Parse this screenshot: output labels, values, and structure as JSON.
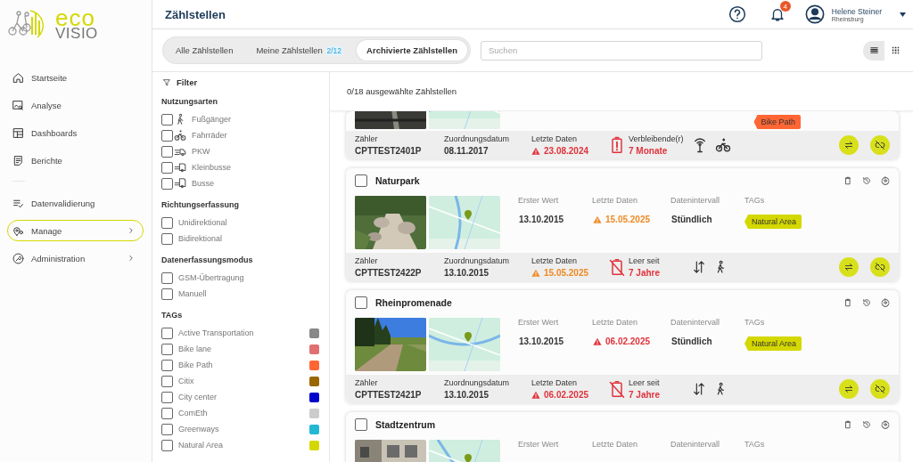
{
  "sidebar": {
    "logo": {
      "line1": "eco",
      "line2": "VISIO"
    },
    "groups": [
      [
        {
          "label": "Startseite",
          "selected": false,
          "expandable": false
        },
        {
          "label": "Analyse",
          "selected": false,
          "expandable": false
        },
        {
          "label": "Dashboards",
          "selected": false,
          "expandable": false
        },
        {
          "label": "Berichte",
          "selected": false,
          "expandable": false
        }
      ],
      [
        {
          "label": "Datenvalidierung",
          "selected": false,
          "expandable": false
        },
        {
          "label": "Manage",
          "selected": true,
          "expandable": true
        },
        {
          "label": "Administration",
          "selected": false,
          "expandable": true
        }
      ]
    ]
  },
  "header": {
    "title": "Zählstellen",
    "notifications": "4",
    "user": {
      "name": "Helene Steiner",
      "location": "Rheinsburg"
    }
  },
  "tabs": [
    {
      "label": "Alle Zählstellen",
      "selected": false
    },
    {
      "label": "Meine Zählstellen",
      "badge": "2/12",
      "selected": false
    },
    {
      "label": "Archivierte Zählstellen",
      "selected": true
    }
  ],
  "search": {
    "placeholder": "Suchen"
  },
  "view_toggle": [
    {
      "kind": "list",
      "selected": true
    },
    {
      "kind": "grid",
      "selected": false
    }
  ],
  "filter": {
    "title": "Filter",
    "sections": [
      {
        "title": "Nutzungsarten",
        "kind": "usage",
        "items": [
          {
            "label": "Fußgänger",
            "checked": false
          },
          {
            "label": "Fahrräder",
            "checked": false
          },
          {
            "label": "PKW",
            "checked": false
          },
          {
            "label": "Kleinbusse",
            "checked": false
          },
          {
            "label": "Busse",
            "checked": false
          }
        ]
      },
      {
        "title": "Richtungserfassung",
        "kind": "plain",
        "items": [
          {
            "label": "Unidirektional",
            "checked": false
          },
          {
            "label": "Bidirektional",
            "checked": false
          }
        ]
      },
      {
        "title": "Datenerfassungsmodus",
        "kind": "plain",
        "items": [
          {
            "label": "GSM-Übertragung",
            "checked": false
          },
          {
            "label": "Manuell",
            "checked": false
          }
        ]
      },
      {
        "title": "TAGs",
        "kind": "tags",
        "items": [
          {
            "label": "Active Transportation",
            "checked": false,
            "color": "#888888"
          },
          {
            "label": "Bike lane",
            "checked": false,
            "color": "#e07070"
          },
          {
            "label": "Bike Path",
            "checked": false,
            "color": "#ff6633"
          },
          {
            "label": "Citix",
            "checked": false,
            "color": "#996600"
          },
          {
            "label": "City center",
            "checked": false,
            "color": "#0000cc"
          },
          {
            "label": "ComEth",
            "checked": false,
            "color": "#cccccc"
          },
          {
            "label": "Greenways",
            "checked": false,
            "color": "#22b8d4"
          },
          {
            "label": "Natural Area",
            "checked": false,
            "color": "#d4d800"
          }
        ]
      }
    ]
  },
  "selection": "0/18 ausgewählte Zählstellen",
  "cards": [
    {
      "tags": [
        {
          "label": "Bike Path",
          "color": "#ff6633"
        }
      ],
      "footer": {
        "counter_label": "Zähler",
        "counter": "CPTTEST2401P",
        "assign_label": "Zuordnungsdatum",
        "assign": "08.11.2017",
        "last_label": "Letzte Daten",
        "last": "23.08.2024",
        "color": "#e0333c",
        "battery_remaining": true,
        "battery_empty": false,
        "battery_label": "Verbleibende(r)",
        "battery_value": "7 Monate",
        "gsm": true,
        "bidirectional": false,
        "bike_usage": true,
        "pedestrian_usage": false
      }
    },
    {
      "title": "Naturpark",
      "checked": false,
      "info": [
        {
          "label": "Erster Wert",
          "value": "13.10.2015",
          "warning": false
        },
        {
          "label": "Letzte Daten",
          "value": "15.05.2025",
          "warning": true,
          "color": "#f08a24"
        },
        {
          "label": "Datenintervall",
          "value": "Stündlich",
          "warning": false
        }
      ],
      "tags_label": "TAGs",
      "tags": [
        {
          "label": "Natural Area",
          "color": "#d4d800"
        }
      ],
      "footer": {
        "counter_label": "Zähler",
        "counter": "CPTTEST2422P",
        "assign_label": "Zuordnungsdatum",
        "assign": "13.10.2015",
        "last_label": "Letzte Daten",
        "last": "15.05.2025",
        "color": "#f08a24",
        "battery_remaining": false,
        "battery_empty": true,
        "battery_label": "Leer seit",
        "battery_value": "7 Jahre",
        "gsm": false,
        "bidirectional": true,
        "bike_usage": false,
        "pedestrian_usage": true
      }
    },
    {
      "title": "Rheinpromenade",
      "checked": false,
      "info": [
        {
          "label": "Erster Wert",
          "value": "13.10.2015",
          "warning": false
        },
        {
          "label": "Letzte Daten",
          "value": "06.02.2025",
          "warning": true,
          "color": "#e0333c"
        },
        {
          "label": "Datenintervall",
          "value": "Stündlich",
          "warning": false
        }
      ],
      "tags_label": "TAGs",
      "tags": [
        {
          "label": "Natural Area",
          "color": "#d4d800"
        }
      ],
      "footer": {
        "counter_label": "Zähler",
        "counter": "CPTTEST2421P",
        "assign_label": "Zuordnungsdatum",
        "assign": "13.10.2015",
        "last_label": "Letzte Daten",
        "last": "06.02.2025",
        "color": "#e0333c",
        "battery_remaining": false,
        "battery_empty": true,
        "battery_label": "Leer seit",
        "battery_value": "7 Jahre",
        "gsm": false,
        "bidirectional": true,
        "bike_usage": false,
        "pedestrian_usage": true
      }
    },
    {
      "title": "Stadtzentrum",
      "checked": false,
      "info": [
        {
          "label": "Erster Wert"
        },
        {
          "label": "Letzte Daten"
        },
        {
          "label": "Datenintervall"
        }
      ],
      "tags_label": "TAGs"
    }
  ]
}
